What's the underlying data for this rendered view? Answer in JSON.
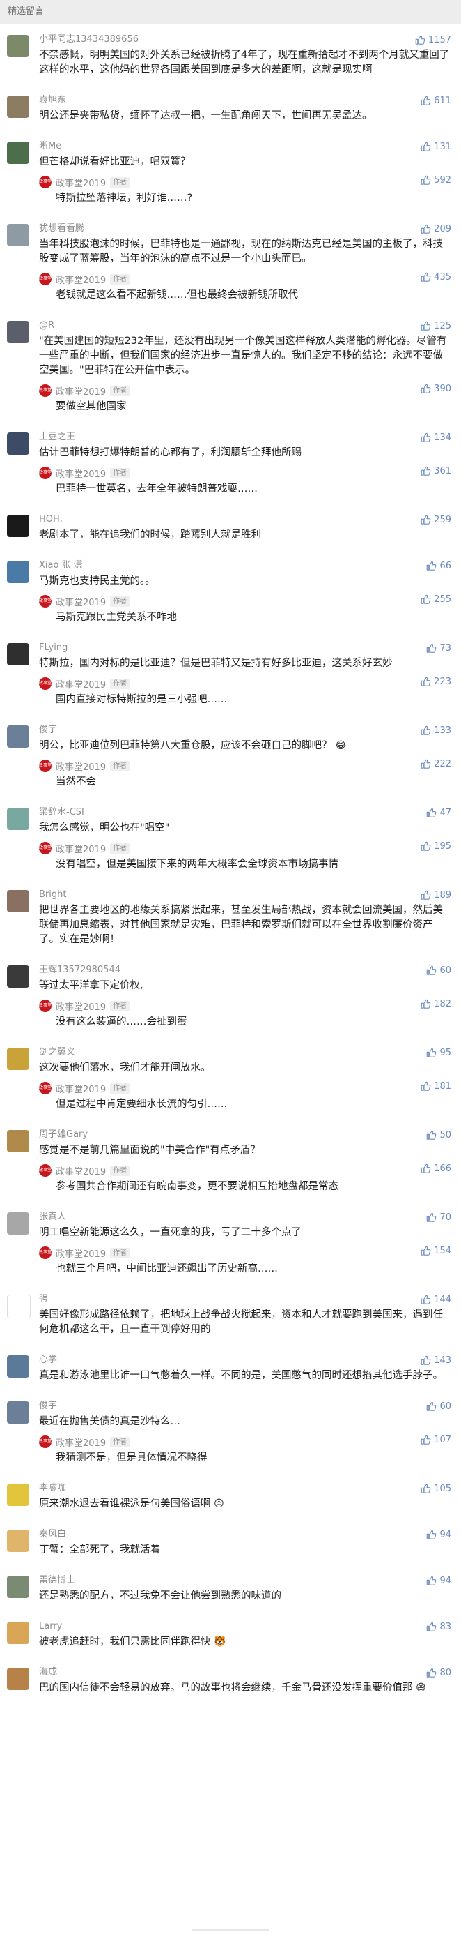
{
  "header": {
    "title": "精选留言"
  },
  "author": {
    "name": "政事堂2019",
    "badge": "作者",
    "avatar_text": "政事堂"
  },
  "comments": [
    {
      "nick": "小平同志13434389656",
      "likes": "1157",
      "avatar_color": "#7d8a6a",
      "text": "不禁感慨，明明美国的对外关系已经被折腾了4年了，现在重新拾起才不到两个月就又重回了这样的水平，这他妈的世界各国跟美国到底是多大的差距啊，这就是现实啊",
      "reply": null
    },
    {
      "nick": "袁旭东",
      "likes": "611",
      "avatar_color": "#8b7c62",
      "text": "明公还是夹带私货，缅怀了达叔一把，一生配角闯天下，世间再无吴孟达。",
      "reply": null
    },
    {
      "nick": "晰Me",
      "likes": "131",
      "avatar_color": "#4d6e4a",
      "text": "但芒格却说看好比亚迪，唱双簧？",
      "reply": {
        "text": "特斯拉坠落神坛，利好谁……?",
        "likes": "592"
      }
    },
    {
      "nick": "犹想看看腾",
      "likes": "209",
      "avatar_color": "#8e9aa4",
      "text": "当年科技股泡沫的时候，巴菲特也是一通鄙视，现在的纳斯达克已经是美国的主板了，科技股变成了蓝筹股，当年的泡沫的高点不过是一个小山头而已。",
      "reply": {
        "text": "老钱就是这么看不起新钱……但也最终会被新钱所取代",
        "likes": "435"
      }
    },
    {
      "nick": "@R",
      "likes": "125",
      "avatar_color": "#5a5f6b",
      "text": "\"在美国建国的短短232年里，还没有出现另一个像美国这样释放人类潜能的孵化器。尽管有一些严重的中断，但我们国家的经济进步一直是惊人的。我们坚定不移的结论：永远不要做空美国。\"巴菲特在公开信中表示。",
      "reply": {
        "text": "要做空其他国家",
        "likes": "390"
      }
    },
    {
      "nick": "土豆之王",
      "likes": "134",
      "avatar_color": "#3e4b67",
      "text": "估计巴菲特想打爆特朗普的心都有了，利润腰斩全拜他所赐",
      "reply": {
        "text": "巴菲特一世英名，去年全年被特朗普戏耍……",
        "likes": "361"
      }
    },
    {
      "nick": "HOH,",
      "likes": "259",
      "avatar_color": "#1a1a1a",
      "text": "老剧本了，能在追我们的时候，踏蔫别人就是胜利",
      "reply": null
    },
    {
      "nick": "Xiao 张 潇",
      "likes": "66",
      "avatar_color": "#4a7ba6",
      "text": "马斯克也支持民主党的。。",
      "reply": {
        "text": "马斯克跟民主党关系不咋地",
        "likes": "255"
      }
    },
    {
      "nick": "FLying",
      "likes": "73",
      "avatar_color": "#2f2f2f",
      "text": "特斯拉，国内对标的是比亚迪？但是巴菲特又是持有好多比亚迪，这关系好玄妙",
      "reply": {
        "text": "国内直接对标特斯拉的是三小强吧……",
        "likes": "223"
      }
    },
    {
      "nick": "俊宇",
      "likes": "133",
      "avatar_color": "#6b7f99",
      "text": "明公，比亚迪位列巴菲特第八大重仓股，应该不会砸自己的脚吧？",
      "emoji": "😂",
      "reply": {
        "text": "当然不会",
        "likes": "222"
      }
    },
    {
      "nick": "梁辞水-CSI",
      "likes": "47",
      "avatar_color": "#79a8a0",
      "text": "我怎么感觉，明公也在\"唱空\"",
      "reply": {
        "text": "没有唱空，但是美国接下来的两年大概率会全球资本市场搞事情",
        "likes": "195"
      }
    },
    {
      "nick": "Bright",
      "likes": "189",
      "avatar_color": "#8a7060",
      "text": "把世界各主要地区的地缘关系搞紧张起来，甚至发生局部热战，资本就会回流美国，然后美联储再加息缩表，对其他国家就是灾难，巴菲特和索罗斯们就可以在全世界收割廉价资产了。实在是妙啊！",
      "reply": null
    },
    {
      "nick": "王辉13572980544",
      "likes": "60",
      "avatar_color": "#3a3a3a",
      "text": "等过太平洋拿下定价权,",
      "reply": {
        "text": "没有这么装逼的……会扯到蛋",
        "likes": "182"
      }
    },
    {
      "nick": "剑之翼义",
      "likes": "95",
      "avatar_color": "#c9a23a",
      "text": "这次要他们落水，我们才能开闸放水。",
      "reply": {
        "text": "但是过程中肯定要细水长流的匀引……",
        "likes": "181"
      }
    },
    {
      "nick": "周子雄Gary",
      "likes": "50",
      "avatar_color": "#b08a4a",
      "text": "感觉是不是前几篇里面说的\"中美合作\"有点矛盾？",
      "reply": {
        "text": "参考国共合作期间还有皖南事变，更不要说相互抬地盘都是常态",
        "likes": "166"
      }
    },
    {
      "nick": "张真人",
      "likes": "70",
      "avatar_color": "#a7a7a7",
      "text": "明工唱空新能源这么久，一直死拿的我，亏了二十多个点了",
      "reply": {
        "text": "也就三个月吧，中间比亚迪还飙出了历史新高……",
        "likes": "154"
      }
    },
    {
      "nick": "强",
      "likes": "144",
      "avatar_color": "#ffffff",
      "text": "美国好像形成路径依赖了，把地球上战争战火搅起来，资本和人才就要跑到美国来，遇到任何危机都这么干，且一直干到停好用的",
      "reply": null
    },
    {
      "nick": "心学",
      "likes": "143",
      "avatar_color": "#5b7a9a",
      "text": "真是和游泳池里比谁一口气憋着久一样。不同的是，美国憋气的同时还想掐其他选手脖子。",
      "reply": null
    },
    {
      "nick": "俊宇",
      "likes": "60",
      "avatar_color": "#6b7f99",
      "text": "最近在抛售美债的真是沙特么…",
      "reply": {
        "text": "我猜测不是，但是具体情况不晓得",
        "likes": "107"
      }
    },
    {
      "nick": "李嘯咖",
      "likes": "105",
      "avatar_color": "#e2c53a",
      "text": "原来潮水退去看谁裸泳是句美国俗语啊",
      "emoji": "😔",
      "reply": null
    },
    {
      "nick": "秦风白",
      "likes": "94",
      "avatar_color": "#e0b46a",
      "text": "丁蟹：全部死了，我就活着",
      "reply": null
    },
    {
      "nick": "雷德博士",
      "likes": "94",
      "avatar_color": "#7b8a72",
      "text": "还是熟悉的配方，不过我免不会让他尝到熟悉的味道的",
      "reply": null
    },
    {
      "nick": "Larry",
      "likes": "83",
      "avatar_color": "#d8a656",
      "text": "被老虎追赶时，我们只需比同伴跑得快",
      "emoji": "🐯",
      "reply": null
    },
    {
      "nick": "海成",
      "likes": "80",
      "avatar_color": "#b68248",
      "text": "巴的国内信徒不会轻易的放弃。马的故事也将会继续，千金马骨还没发挥重要价值那",
      "emoji": "😅",
      "reply": null
    }
  ]
}
